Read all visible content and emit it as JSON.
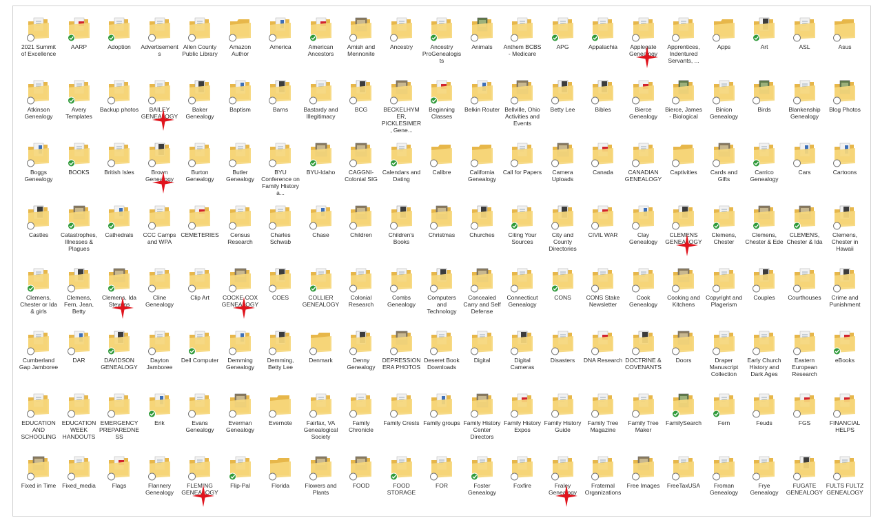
{
  "colors": {
    "folder_back": "#e7b74a",
    "folder_front": "#f6d77c",
    "paper": "#f2f2f2",
    "sync_ok": "#2f9a3a",
    "sync_pending": "#ffffff",
    "marker": "#e0141d"
  },
  "folders": [
    {
      "label": "2021 Summit of Excellence",
      "status": "pending",
      "thumb": "doc"
    },
    {
      "label": "AARP",
      "status": "ok",
      "thumb": "red"
    },
    {
      "label": "Adoption",
      "status": "ok",
      "thumb": "doc"
    },
    {
      "label": "Advertisements",
      "status": "pending",
      "thumb": "doc"
    },
    {
      "label": "Allen County Public Library",
      "status": "pending",
      "thumb": "doc"
    },
    {
      "label": "Amazon Author",
      "status": "pending",
      "thumb": "none"
    },
    {
      "label": "America",
      "status": "pending",
      "thumb": "blue"
    },
    {
      "label": "American Ancestors",
      "status": "ok",
      "thumb": "red"
    },
    {
      "label": "Amish and Mennonite",
      "status": "pending",
      "thumb": "photo"
    },
    {
      "label": "Ancestry",
      "status": "pending",
      "thumb": "doc"
    },
    {
      "label": "Ancestry ProGenealogists",
      "status": "ok",
      "thumb": "doc"
    },
    {
      "label": "Animals",
      "status": "pending",
      "thumb": "green"
    },
    {
      "label": "Anthem BCBS - Medicare",
      "status": "pending",
      "thumb": "doc"
    },
    {
      "label": "APG",
      "status": "ok",
      "thumb": "doc"
    },
    {
      "label": "Appalachia",
      "status": "ok",
      "thumb": "doc"
    },
    {
      "label": "Applegate Genealogy",
      "status": "pending",
      "thumb": "doc"
    },
    {
      "label": "Apprentices, Indentured Servants, ...",
      "status": "pending",
      "thumb": "doc"
    },
    {
      "label": "Apps",
      "status": "pending",
      "thumb": "none"
    },
    {
      "label": "Art",
      "status": "ok",
      "thumb": "dark"
    },
    {
      "label": "ASL",
      "status": "pending",
      "thumb": "doc"
    },
    {
      "label": "Asus",
      "status": "pending",
      "thumb": "none"
    },
    {
      "label": "Atkinson Genealogy",
      "status": "pending",
      "thumb": "doc"
    },
    {
      "label": "Avery Templates",
      "status": "ok",
      "thumb": "doc"
    },
    {
      "label": "Backup photos",
      "status": "pending",
      "thumb": "doc"
    },
    {
      "label": "BAILEY GENEALOGY",
      "status": "pending",
      "thumb": "doc"
    },
    {
      "label": "Baker Genealogy",
      "status": "pending",
      "thumb": "dark"
    },
    {
      "label": "Baptism",
      "status": "pending",
      "thumb": "blue"
    },
    {
      "label": "Barns",
      "status": "pending",
      "thumb": "dark"
    },
    {
      "label": "Bastardy and Illegitimacy",
      "status": "pending",
      "thumb": "doc"
    },
    {
      "label": "BCG",
      "status": "pending",
      "thumb": "dark"
    },
    {
      "label": "BECKELHYMER, PICKLESIMER, Gene...",
      "status": "pending",
      "thumb": "photo"
    },
    {
      "label": "Beginning Classes",
      "status": "ok",
      "thumb": "red"
    },
    {
      "label": "Belkin Router",
      "status": "pending",
      "thumb": "blue"
    },
    {
      "label": "Bellville, Ohio Activities and Events",
      "status": "pending",
      "thumb": "photo"
    },
    {
      "label": "Betty Lee",
      "status": "pending",
      "thumb": "dark"
    },
    {
      "label": "Bibles",
      "status": "pending",
      "thumb": "dark"
    },
    {
      "label": "Bierce Genealogy",
      "status": "pending",
      "thumb": "red"
    },
    {
      "label": "Bierce, James - Biological",
      "status": "pending",
      "thumb": "green"
    },
    {
      "label": "Binion Genealogy",
      "status": "pending",
      "thumb": "doc"
    },
    {
      "label": "Birds",
      "status": "pending",
      "thumb": "green"
    },
    {
      "label": "Blankenship Genealogy",
      "status": "pending",
      "thumb": "doc"
    },
    {
      "label": "Blog Photos",
      "status": "pending",
      "thumb": "green"
    },
    {
      "label": "Boggs Genealogy",
      "status": "pending",
      "thumb": "blue"
    },
    {
      "label": "BOOKS",
      "status": "ok",
      "thumb": "doc"
    },
    {
      "label": "British Isles",
      "status": "pending",
      "thumb": "doc"
    },
    {
      "label": "Brown Genealogy",
      "status": "pending",
      "thumb": "dark"
    },
    {
      "label": "Burton Genealogy",
      "status": "pending",
      "thumb": "doc"
    },
    {
      "label": "Butler Genealogy",
      "status": "pending",
      "thumb": "doc"
    },
    {
      "label": "BYU Conference on Family History a...",
      "status": "pending",
      "thumb": "doc"
    },
    {
      "label": "BYU-Idaho",
      "status": "ok",
      "thumb": "photo"
    },
    {
      "label": "CAGGNI-Colonial SIG",
      "status": "pending",
      "thumb": "photo"
    },
    {
      "label": "Calendars and Dating",
      "status": "ok",
      "thumb": "doc"
    },
    {
      "label": "Calibre",
      "status": "pending",
      "thumb": "none"
    },
    {
      "label": "California Genealogy",
      "status": "pending",
      "thumb": "none"
    },
    {
      "label": "Call for Papers",
      "status": "pending",
      "thumb": "doc"
    },
    {
      "label": "Camera Uploads",
      "status": "pending",
      "thumb": "photo"
    },
    {
      "label": "Canada",
      "status": "pending",
      "thumb": "red"
    },
    {
      "label": "CANADIAN GENEALOGY",
      "status": "pending",
      "thumb": "doc"
    },
    {
      "label": "Captivities",
      "status": "pending",
      "thumb": "none"
    },
    {
      "label": "Cards and Gifts",
      "status": "pending",
      "thumb": "photo"
    },
    {
      "label": "Carrico Genealogy",
      "status": "ok",
      "thumb": "doc"
    },
    {
      "label": "Cars",
      "status": "pending",
      "thumb": "blue"
    },
    {
      "label": "Cartoons",
      "status": "pending",
      "thumb": "blue"
    },
    {
      "label": "Castles",
      "status": "pending",
      "thumb": "dark"
    },
    {
      "label": "Catastrophes, Illnesses & Plagues",
      "status": "ok",
      "thumb": "photo"
    },
    {
      "label": "Cathedrals",
      "status": "ok",
      "thumb": "blue"
    },
    {
      "label": "CCC Camps and WPA",
      "status": "pending",
      "thumb": "doc"
    },
    {
      "label": "CEMETERIES",
      "status": "pending",
      "thumb": "red"
    },
    {
      "label": "Census Research",
      "status": "pending",
      "thumb": "doc"
    },
    {
      "label": "Charles Schwab",
      "status": "pending",
      "thumb": "doc"
    },
    {
      "label": "Chase",
      "status": "pending",
      "thumb": "blue"
    },
    {
      "label": "Children",
      "status": "pending",
      "thumb": "photo"
    },
    {
      "label": "Children's Books",
      "status": "pending",
      "thumb": "dark"
    },
    {
      "label": "Christmas",
      "status": "pending",
      "thumb": "photo"
    },
    {
      "label": "Churches",
      "status": "pending",
      "thumb": "dark"
    },
    {
      "label": "Citing Your Sources",
      "status": "ok",
      "thumb": "doc"
    },
    {
      "label": "City and County Directories",
      "status": "pending",
      "thumb": "dark"
    },
    {
      "label": "CIVIL WAR",
      "status": "pending",
      "thumb": "red"
    },
    {
      "label": "Clay Genealogy",
      "status": "pending",
      "thumb": "blue"
    },
    {
      "label": "CLEMENS GENEALOGY",
      "status": "pending",
      "thumb": "dark"
    },
    {
      "label": "Clemens, Chester",
      "status": "ok",
      "thumb": "doc"
    },
    {
      "label": "Clemens, Chester & Ede",
      "status": "ok",
      "thumb": "photo"
    },
    {
      "label": "CLEMENS, Chester & Ida",
      "status": "ok",
      "thumb": "photo"
    },
    {
      "label": "Clemens, Chester in Hawaii",
      "status": "pending",
      "thumb": "dark"
    },
    {
      "label": "Clemens, Chester or Ida & girls",
      "status": "ok",
      "thumb": "doc"
    },
    {
      "label": "Clemens, Fern, Jean, Betty",
      "status": "pending",
      "thumb": "dark"
    },
    {
      "label": "Clemens, Ida Stevens",
      "status": "ok",
      "thumb": "photo"
    },
    {
      "label": "Cline Genealogy",
      "status": "pending",
      "thumb": "doc"
    },
    {
      "label": "Clip Art",
      "status": "pending",
      "thumb": "doc"
    },
    {
      "label": "COCKE COX GENEALOGY",
      "status": "pending",
      "thumb": "photo"
    },
    {
      "label": "COES",
      "status": "pending",
      "thumb": "dark"
    },
    {
      "label": "COLLIER GENEALOGY",
      "status": "ok",
      "thumb": "doc"
    },
    {
      "label": "Colonial Research",
      "status": "pending",
      "thumb": "doc"
    },
    {
      "label": "Combs Genealogy",
      "status": "pending",
      "thumb": "doc"
    },
    {
      "label": "Computers and Technology",
      "status": "pending",
      "thumb": "dark"
    },
    {
      "label": "Concealed Carry and Self Defense",
      "status": "pending",
      "thumb": "photo"
    },
    {
      "label": "Connecticut Genealogy",
      "status": "pending",
      "thumb": "doc"
    },
    {
      "label": "CONS",
      "status": "ok",
      "thumb": "doc"
    },
    {
      "label": "CONS Stake Newsletter",
      "status": "pending",
      "thumb": "doc"
    },
    {
      "label": "Cook Genealogy",
      "status": "pending",
      "thumb": "doc"
    },
    {
      "label": "Cooking and Kitchens",
      "status": "pending",
      "thumb": "photo"
    },
    {
      "label": "Copyright and Plagerism",
      "status": "pending",
      "thumb": "doc"
    },
    {
      "label": "Couples",
      "status": "pending",
      "thumb": "dark"
    },
    {
      "label": "Courthouses",
      "status": "pending",
      "thumb": "doc"
    },
    {
      "label": "Crime and Punishment",
      "status": "pending",
      "thumb": "dark"
    },
    {
      "label": "Cumberland Gap Jamboree",
      "status": "pending",
      "thumb": "doc"
    },
    {
      "label": "DAR",
      "status": "pending",
      "thumb": "blue"
    },
    {
      "label": "DAVIDSON GENEALOGY",
      "status": "ok",
      "thumb": "dark"
    },
    {
      "label": "Dayton Jamboree",
      "status": "pending",
      "thumb": "doc"
    },
    {
      "label": "Dell Computer",
      "status": "ok",
      "thumb": "doc"
    },
    {
      "label": "Demming Genealogy",
      "status": "pending",
      "thumb": "blue"
    },
    {
      "label": "Demming, Betty Lee",
      "status": "pending",
      "thumb": "dark"
    },
    {
      "label": "Denmark",
      "status": "pending",
      "thumb": "none"
    },
    {
      "label": "Denny Genealogy",
      "status": "pending",
      "thumb": "dark"
    },
    {
      "label": "DEPRESSION ERA PHOTOS",
      "status": "pending",
      "thumb": "photo"
    },
    {
      "label": "Deseret Book Downloads",
      "status": "pending",
      "thumb": "doc"
    },
    {
      "label": "Digital",
      "status": "pending",
      "thumb": "doc"
    },
    {
      "label": "Digital Cameras",
      "status": "pending",
      "thumb": "dark"
    },
    {
      "label": "Disasters",
      "status": "pending",
      "thumb": "doc"
    },
    {
      "label": "DNA Research",
      "status": "pending",
      "thumb": "red"
    },
    {
      "label": "DOCTRINE & COVENANTS",
      "status": "pending",
      "thumb": "dark"
    },
    {
      "label": "Doors",
      "status": "pending",
      "thumb": "photo"
    },
    {
      "label": "Draper Manuscript Collection",
      "status": "pending",
      "thumb": "doc"
    },
    {
      "label": "Early Church History and Dark Ages",
      "status": "pending",
      "thumb": "doc"
    },
    {
      "label": "Eastern European Research",
      "status": "pending",
      "thumb": "doc"
    },
    {
      "label": "eBooks",
      "status": "ok",
      "thumb": "red"
    },
    {
      "label": "EDUCATION AND SCHOOLING",
      "status": "pending",
      "thumb": "doc"
    },
    {
      "label": "EDUCATION WEEK HANDOUTS",
      "status": "pending",
      "thumb": "doc"
    },
    {
      "label": "EMERGENCY PREPAREDNESS",
      "status": "pending",
      "thumb": "doc"
    },
    {
      "label": "Erik",
      "status": "ok",
      "thumb": "blue"
    },
    {
      "label": "Evans Genealogy",
      "status": "pending",
      "thumb": "doc"
    },
    {
      "label": "Everman Genealogy",
      "status": "pending",
      "thumb": "photo"
    },
    {
      "label": "Evernote",
      "status": "pending",
      "thumb": "none"
    },
    {
      "label": "Fairfax, VA Genealogical Society",
      "status": "pending",
      "thumb": "doc"
    },
    {
      "label": "Family Chronicle",
      "status": "pending",
      "thumb": "doc"
    },
    {
      "label": "Family Crests",
      "status": "pending",
      "thumb": "doc"
    },
    {
      "label": "Family groups",
      "status": "pending",
      "thumb": "blue"
    },
    {
      "label": "Family History Center Directors",
      "status": "pending",
      "thumb": "photo"
    },
    {
      "label": "Family History Expos",
      "status": "pending",
      "thumb": "red"
    },
    {
      "label": "Family History Guide",
      "status": "pending",
      "thumb": "doc"
    },
    {
      "label": "Family Tree Magazine",
      "status": "pending",
      "thumb": "doc"
    },
    {
      "label": "Family Tree Maker",
      "status": "pending",
      "thumb": "doc"
    },
    {
      "label": "FamilySearch",
      "status": "ok",
      "thumb": "green"
    },
    {
      "label": "Fern",
      "status": "ok",
      "thumb": "doc"
    },
    {
      "label": "Feuds",
      "status": "pending",
      "thumb": "doc"
    },
    {
      "label": "FGS",
      "status": "pending",
      "thumb": "red"
    },
    {
      "label": "FINANCIAL HELPS",
      "status": "pending",
      "thumb": "red"
    },
    {
      "label": "Fixed in Time",
      "status": "pending",
      "thumb": "photo"
    },
    {
      "label": "Fixed_media",
      "status": "pending",
      "thumb": "doc"
    },
    {
      "label": "Flags",
      "status": "pending",
      "thumb": "red"
    },
    {
      "label": "Flannery Genealogy",
      "status": "pending",
      "thumb": "doc"
    },
    {
      "label": "FLEMING GENEALOGY",
      "status": "pending",
      "thumb": "doc"
    },
    {
      "label": "Flip-Pal",
      "status": "ok",
      "thumb": "doc"
    },
    {
      "label": "Florida",
      "status": "pending",
      "thumb": "none"
    },
    {
      "label": "Flowers and Plants",
      "status": "pending",
      "thumb": "photo"
    },
    {
      "label": "FOOD",
      "status": "pending",
      "thumb": "photo"
    },
    {
      "label": "FOOD STORAGE",
      "status": "ok",
      "thumb": "doc"
    },
    {
      "label": "FOR",
      "status": "pending",
      "thumb": "doc"
    },
    {
      "label": "Foster Genealogy",
      "status": "ok",
      "thumb": "doc"
    },
    {
      "label": "Foxfire",
      "status": "pending",
      "thumb": "doc"
    },
    {
      "label": "Fraley Genealogy",
      "status": "pending",
      "thumb": "doc"
    },
    {
      "label": "Fraternal Organizations",
      "status": "pending",
      "thumb": "doc"
    },
    {
      "label": "Free Images",
      "status": "pending",
      "thumb": "photo"
    },
    {
      "label": "FreeTaxUSA",
      "status": "pending",
      "thumb": "doc"
    },
    {
      "label": "Froman Genealogy",
      "status": "pending",
      "thumb": "doc"
    },
    {
      "label": "Frye Genealogy",
      "status": "pending",
      "thumb": "doc"
    },
    {
      "label": "FUGATE GENEALOGY",
      "status": "pending",
      "thumb": "dark"
    },
    {
      "label": "FULTS FULTZ GENEALOGY",
      "status": "pending",
      "thumb": "doc"
    }
  ],
  "markers": [
    {
      "folder": "Applegate Genealogy"
    },
    {
      "folder": "BAILEY GENEALOGY"
    },
    {
      "folder": "Brown Genealogy"
    },
    {
      "folder": "CLEMENS GENEALOGY"
    },
    {
      "folder": "Clemens, Ida Stevens"
    },
    {
      "folder": "COCKE COX GENEALOGY"
    },
    {
      "folder": "FLEMING GENEALOGY"
    },
    {
      "folder": "Fraley Genealogy"
    }
  ]
}
